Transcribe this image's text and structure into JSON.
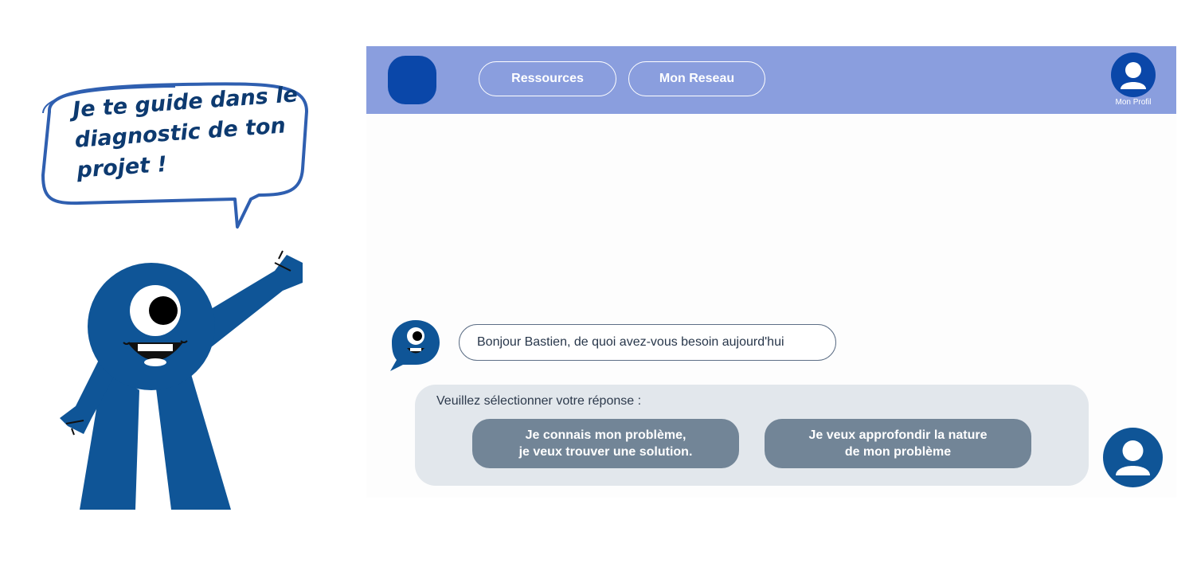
{
  "illustration": {
    "speech_line1": "Je te guide dans le",
    "speech_line2": "diagnostic de ton",
    "speech_line3": "projet !",
    "mascot_icon": "waving-mascot-icon"
  },
  "topbar": {
    "logo_icon": "app-logo",
    "nav": [
      {
        "label": "Ressources"
      },
      {
        "label": "Mon Reseau"
      }
    ],
    "profile_label": "Mon Profil",
    "profile_icon": "user-icon"
  },
  "chat": {
    "bot_message": "Bonjour Bastien, de quoi avez-vous besoin aujourd'hui",
    "reply_prompt": "Veuillez sélectionner votre réponse :",
    "choices": [
      {
        "line1": "Je connais mon problème,",
        "line2": "je veux trouver une solution."
      },
      {
        "line1": "Je veux approfondir la nature",
        "line2": "de mon problème"
      }
    ]
  },
  "colors": {
    "topbar": "#8a9ede",
    "brand_blue": "#0a47a9",
    "mascot_blue": "#0f5597",
    "choice_button": "#728597",
    "panel": "#e2e7ec"
  }
}
